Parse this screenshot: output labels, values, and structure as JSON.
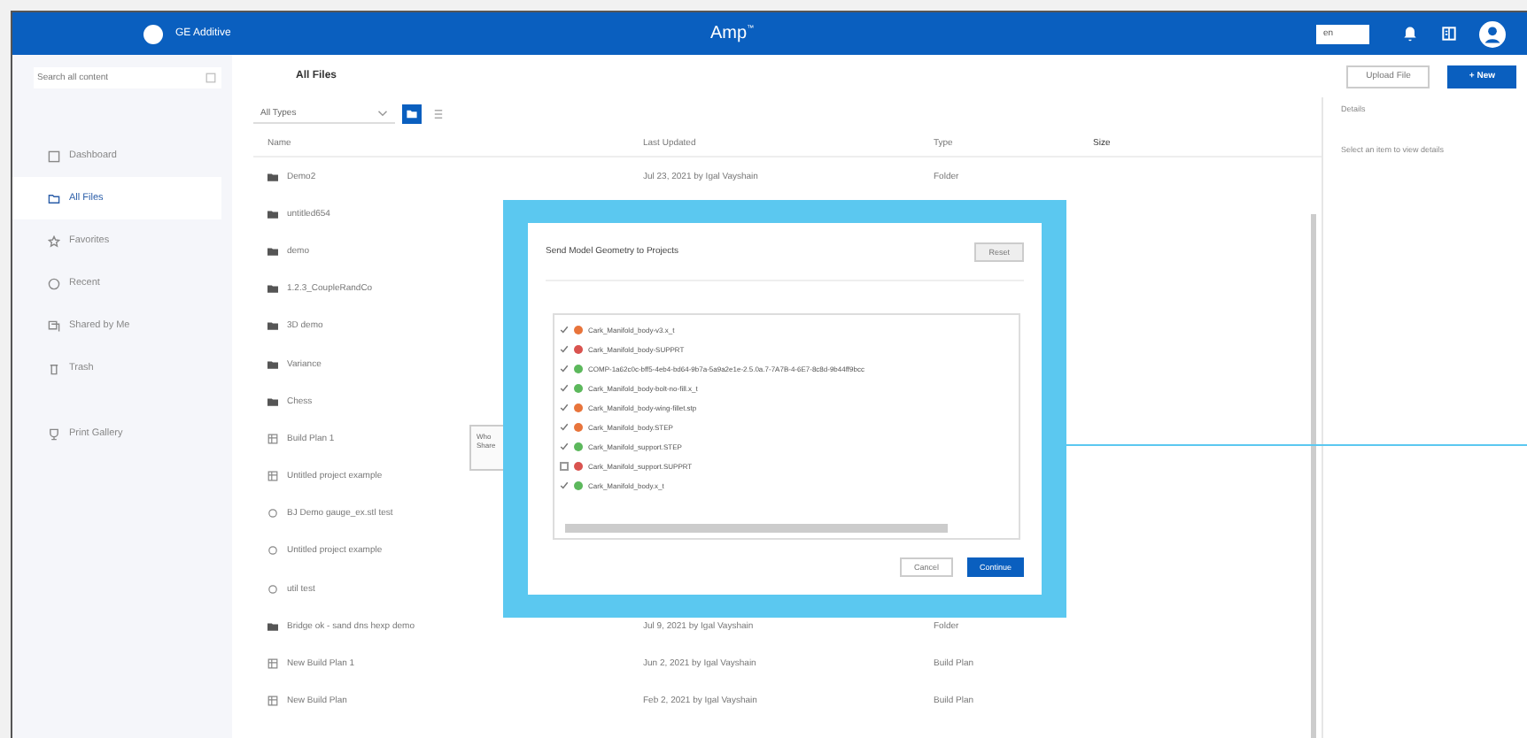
{
  "header": {
    "brand": "GE Additive",
    "app_title": "Amp",
    "superscript": "™",
    "lang_field": "en"
  },
  "search": {
    "placeholder": "Search all content"
  },
  "page_title": "All Files",
  "actions": {
    "upload": "Upload File",
    "new": "New",
    "new_icon": "+"
  },
  "sidebar": {
    "items": [
      {
        "label": "Dashboard",
        "selected": false
      },
      {
        "label": "All Files",
        "selected": true
      },
      {
        "label": "Favorites",
        "selected": false
      },
      {
        "label": "Recent",
        "selected": false
      },
      {
        "label": "Shared by Me",
        "selected": false
      },
      {
        "label": "Trash",
        "selected": false
      },
      {
        "label": "Print Gallery",
        "selected": false
      }
    ]
  },
  "filter": {
    "value": "All Types",
    "views": [
      {
        "kind": "folder",
        "selected": true
      },
      {
        "kind": "list",
        "selected": false
      }
    ]
  },
  "table": {
    "columns": [
      "Name",
      "Last Updated",
      "Type",
      "Size"
    ],
    "rows": [
      {
        "kind": "folder",
        "name": "Demo2",
        "updated": "Jul 23, 2021 by Igal Vayshain",
        "type": "Folder"
      },
      {
        "kind": "folder",
        "name": "untitled654"
      },
      {
        "kind": "folder",
        "name": "demo"
      },
      {
        "kind": "folder",
        "name": "1.2.3_CoupleRandCo"
      },
      {
        "kind": "folder",
        "name": "3D demo"
      },
      {
        "kind": "folder",
        "name": "Variance"
      },
      {
        "kind": "folder",
        "name": "Chess"
      },
      {
        "kind": "plan",
        "name": "Build Plan 1"
      },
      {
        "kind": "plan",
        "name": "Untitled project example"
      },
      {
        "kind": "part",
        "name": "BJ Demo gauge_ex.stl test"
      },
      {
        "kind": "part",
        "name": "Untitled project example"
      },
      {
        "kind": "part",
        "name": "util test"
      },
      {
        "kind": "folder",
        "name": "Bridge ok - sand dns hexp demo",
        "updated": "Jul 9, 2021 by Igal Vayshain",
        "type": "Folder"
      },
      {
        "kind": "plan",
        "name": "New Build Plan 1",
        "updated": "Jun 2, 2021 by Igal Vayshain",
        "type": "Build Plan"
      },
      {
        "kind": "plan",
        "name": "New Build Plan",
        "updated": "Feb 2, 2021 by Igal Vayshain",
        "type": "Build Plan"
      }
    ]
  },
  "details": {
    "title": "Details",
    "hint": "Select an item to view details"
  },
  "tooltip": {
    "lines": [
      "Who",
      "Share"
    ]
  },
  "dialog": {
    "title": "Send Model Geometry to Projects",
    "reset": "Reset",
    "items": [
      {
        "label": "Cark_Manifold_body-v3.x_t",
        "checked": true,
        "color": "#e8743b"
      },
      {
        "label": "Cark_Manifold_body-SUPPRT",
        "checked": true,
        "color": "#d9534f"
      },
      {
        "label": "COMP-1a62c0c-bff5-4eb4-bd64-9b7a-5a9a2e1e-2.5.0a.7-7A7B-4-6E7-8c8d-9b44ff9bcc",
        "checked": true,
        "color": "#5cb85c"
      },
      {
        "label": "Cark_Manifold_body-bolt-no-fill.x_t",
        "checked": true,
        "color": "#5cb85c"
      },
      {
        "label": "Cark_Manifold_body-wing-fillet.stp",
        "checked": true,
        "color": "#e8743b"
      },
      {
        "label": "Cark_Manifold_body.STEP",
        "checked": true,
        "color": "#e8743b"
      },
      {
        "label": "Cark_Manifold_support.STEP",
        "checked": true,
        "color": "#5cb85c"
      },
      {
        "label": "Cark_Manifold_support.SUPPRT",
        "checked": false,
        "color": "#d9534f"
      },
      {
        "label": "Cark_Manifold_body.x_t",
        "checked": true,
        "color": "#5cb85c"
      }
    ],
    "cancel": "Cancel",
    "continue": "Continue"
  }
}
